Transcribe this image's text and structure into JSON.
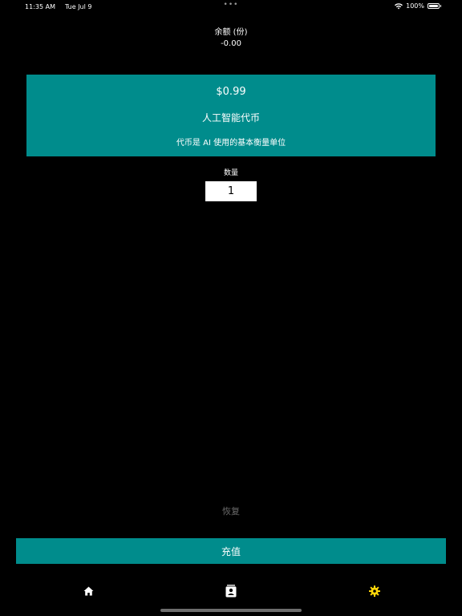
{
  "status_bar": {
    "time": "11:35 AM",
    "date": "Tue Jul 9",
    "battery_text": "100%",
    "battery_level": 1.0,
    "icons": [
      "wifi-icon",
      "battery-icon"
    ]
  },
  "balance": {
    "label": "余额 (份)",
    "value": "-0.00"
  },
  "product": {
    "price": "$0.99",
    "name": "人工智能代币",
    "description": "代币是 AI 使用的基本衡量单位"
  },
  "quantity": {
    "label": "数量",
    "value": "1"
  },
  "actions": {
    "restore_label": "恢复",
    "recharge_label": "充值"
  },
  "tab_bar": {
    "tabs": [
      {
        "icon": "home-icon",
        "selected": false
      },
      {
        "icon": "contacts-icon",
        "selected": false
      },
      {
        "icon": "settings-icon",
        "selected": true
      }
    ]
  },
  "colors": {
    "background": "#000000",
    "accent": "#008c8c",
    "selected_tab": "#ffd60a",
    "restore_text": "#6b6b6b"
  }
}
